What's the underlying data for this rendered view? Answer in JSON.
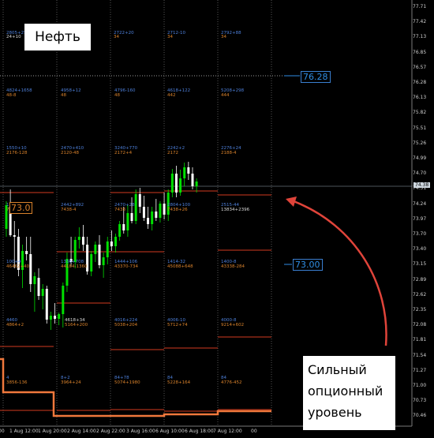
{
  "title_label": "Нефть",
  "annotation": "Сильный опционный уровень",
  "annotation_lines": [
    "Сильный",
    "опционный",
    "уровень"
  ],
  "levels": {
    "upper": "76.28",
    "lower": "73.00",
    "highlight": "73.0"
  },
  "current_price": "74.38",
  "price_axis": [
    "77.71",
    "77.42",
    "77.13",
    "76.85",
    "76.57",
    "76.28",
    "76.13",
    "75.82",
    "75.51",
    "75.26",
    "74.99",
    "74.70",
    "74.51",
    "74.24",
    "73.97",
    "73.70",
    "73.40",
    "73.15",
    "72.89",
    "72.62",
    "72.35",
    "72.08",
    "71.81",
    "71.54",
    "71.27",
    "71.00",
    "70.73",
    "70.46"
  ],
  "time_axis": [
    "00",
    "1 Aug 12:00",
    "1 Aug 20:00",
    "2 Aug 14:00",
    "2 Aug 22:00",
    "3 Aug 16:00",
    "6 Aug 10:00",
    "6 Aug 18:00",
    "7 Aug 12:00",
    "00"
  ],
  "option_labels": [
    {
      "t": "2805+250",
      "c": "b"
    },
    {
      "t": "24+10",
      "c": "w"
    },
    {
      "t": "2722+20",
      "c": "b"
    },
    {
      "t": "34",
      "c": "o"
    },
    {
      "t": "2712-10",
      "c": "b"
    },
    {
      "t": "34",
      "c": "o"
    },
    {
      "t": "2792+88",
      "c": "b"
    },
    {
      "t": "34",
      "c": "o"
    },
    {
      "t": "4824+1658",
      "c": "b"
    },
    {
      "t": "48-8",
      "c": "o"
    },
    {
      "t": "4958+12",
      "c": "b"
    },
    {
      "t": "48",
      "c": "o"
    },
    {
      "t": "4796-160",
      "c": "b"
    },
    {
      "t": "48",
      "c": "o"
    },
    {
      "t": "4618+122",
      "c": "b"
    },
    {
      "t": "442",
      "c": "o"
    },
    {
      "t": "5208+298",
      "c": "b"
    },
    {
      "t": "444",
      "c": "o"
    },
    {
      "t": "1550+10",
      "c": "b"
    },
    {
      "t": "2176-128",
      "c": "o"
    },
    {
      "t": "2470+410",
      "c": "b"
    },
    {
      "t": "2120-48",
      "c": "o"
    },
    {
      "t": "3240+770",
      "c": "b"
    },
    {
      "t": "2172+4",
      "c": "o"
    },
    {
      "t": "2242+2",
      "c": "b"
    },
    {
      "t": "2172",
      "c": "o"
    },
    {
      "t": "2276+24",
      "c": "b"
    },
    {
      "t": "2188-4",
      "c": "o"
    },
    {
      "t": "1954+4",
      "c": "b"
    },
    {
      "t": "7426+24",
      "c": "o"
    },
    {
      "t": "2442+892",
      "c": "b"
    },
    {
      "t": "7438-4",
      "c": "o"
    },
    {
      "t": "2470+28",
      "c": "b"
    },
    {
      "t": "7438",
      "c": "o"
    },
    {
      "t": "2804+100",
      "c": "b"
    },
    {
      "t": "7438+26",
      "c": "o"
    },
    {
      "t": "2515-44",
      "c": "b"
    },
    {
      "t": "13834+2396",
      "c": "w"
    },
    {
      "t": "100+4",
      "c": "b"
    },
    {
      "t": "46462+40",
      "c": "o"
    },
    {
      "t": "1336+708",
      "c": "b"
    },
    {
      "t": "44184-1360",
      "c": "o"
    },
    {
      "t": "1444+106",
      "c": "b"
    },
    {
      "t": "43370-734",
      "c": "o"
    },
    {
      "t": "1414-32",
      "c": "b"
    },
    {
      "t": "45088+648",
      "c": "o"
    },
    {
      "t": "1400-8",
      "c": "b"
    },
    {
      "t": "43338-284",
      "c": "o"
    },
    {
      "t": "4460",
      "c": "b"
    },
    {
      "t": "4864+2",
      "c": "o"
    },
    {
      "t": "4618+34",
      "c": "w"
    },
    {
      "t": "5164+200",
      "c": "o"
    },
    {
      "t": "4016+224",
      "c": "b"
    },
    {
      "t": "5038+204",
      "c": "o"
    },
    {
      "t": "4006-10",
      "c": "b"
    },
    {
      "t": "5712+74",
      "c": "o"
    },
    {
      "t": "4000-8",
      "c": "b"
    },
    {
      "t": "9214+602",
      "c": "o"
    },
    {
      "t": "4",
      "c": "b"
    },
    {
      "t": "3856-136",
      "c": "o"
    },
    {
      "t": "8+2",
      "c": "b"
    },
    {
      "t": "3964+24",
      "c": "o"
    },
    {
      "t": "84+78",
      "c": "b"
    },
    {
      "t": "5074+1980",
      "c": "o"
    },
    {
      "t": "84",
      "c": "b"
    },
    {
      "t": "5228+164",
      "c": "o"
    },
    {
      "t": "84",
      "c": "b"
    },
    {
      "t": "4776-452",
      "c": "o"
    }
  ],
  "colors": {
    "bull": "#00e000",
    "bear": "#ffffff",
    "call": "#4d7fd9",
    "put": "#d9822b",
    "arrow": "#e0443a",
    "level": "#2f8de4"
  }
}
